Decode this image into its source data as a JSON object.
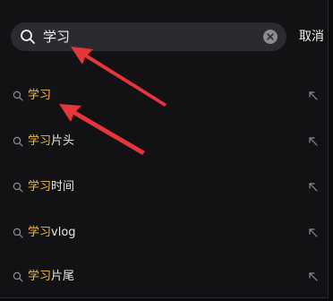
{
  "search": {
    "query": "学习",
    "cancel_label": "取消"
  },
  "suggestions": [
    {
      "highlight": "学习",
      "rest": ""
    },
    {
      "highlight": "学习",
      "rest": "片头"
    },
    {
      "highlight": "学习",
      "rest": "时间"
    },
    {
      "highlight": "学习",
      "rest": "vlog"
    },
    {
      "highlight": "学习",
      "rest": "片尾"
    }
  ],
  "colors": {
    "highlight": "#f0bd3b",
    "annotation_arrow": "#e8353a"
  }
}
